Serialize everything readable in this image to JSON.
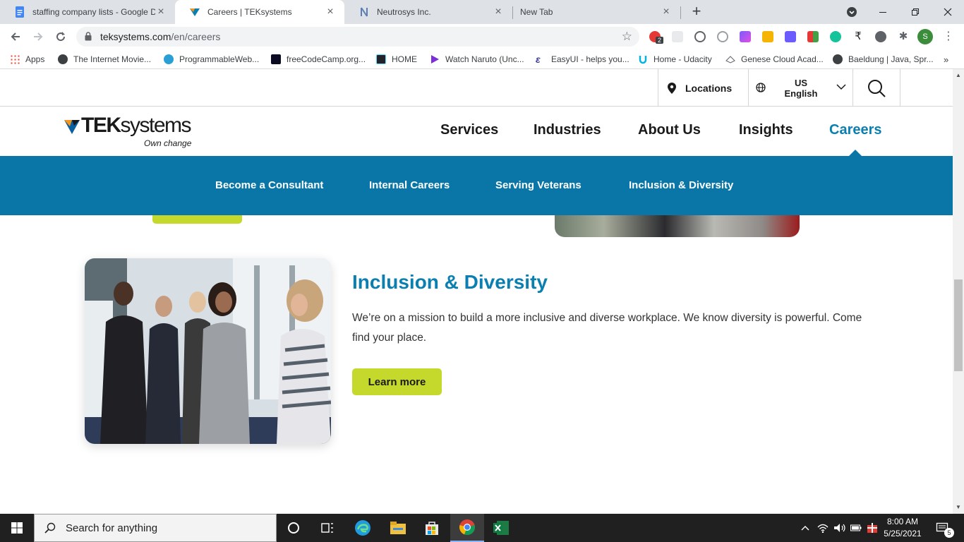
{
  "browser": {
    "tabs": [
      {
        "title": "staffing company lists - Google Docs",
        "active": false
      },
      {
        "title": "Careers | TEKsystems",
        "active": true
      },
      {
        "title": "Neutrosys Inc.",
        "active": false
      },
      {
        "title": "New Tab",
        "active": false
      }
    ],
    "url_host": "teksystems.com",
    "url_path": "/en/careers",
    "profile_initial": "S",
    "ext_badge": "2",
    "bookmarks": [
      "Apps",
      "The Internet Movie...",
      "ProgrammableWeb...",
      "freeCodeCamp.org...",
      "HOME",
      "Watch Naruto (Unc...",
      "EasyUI - helps you...",
      "Home - Udacity",
      "Genese Cloud Acad...",
      "Baeldung | Java, Spr..."
    ]
  },
  "site": {
    "util": {
      "locations": "Locations",
      "lang_line1": "US",
      "lang_line2": "English"
    },
    "logo": {
      "brand_bold": "TEK",
      "brand_light": "systems",
      "tagline": "Own change"
    },
    "nav": [
      "Services",
      "Industries",
      "About Us",
      "Insights",
      "Careers"
    ],
    "subnav": [
      "Become a Consultant",
      "Internal Careers",
      "Serving Veterans",
      "Inclusion & Diversity"
    ],
    "section": {
      "title": "Inclusion & Diversity",
      "body": "We’re on a mission to build a more inclusive and diverse workplace. We know diversity is powerful. Come find your place.",
      "button": "Learn more"
    },
    "colors": {
      "brand_blue": "#0a76a8",
      "accent_green": "#c5d92d"
    }
  },
  "taskbar": {
    "search_placeholder": "Search for anything",
    "time": "8:00 AM",
    "date": "5/25/2021",
    "notification_count": "5"
  }
}
